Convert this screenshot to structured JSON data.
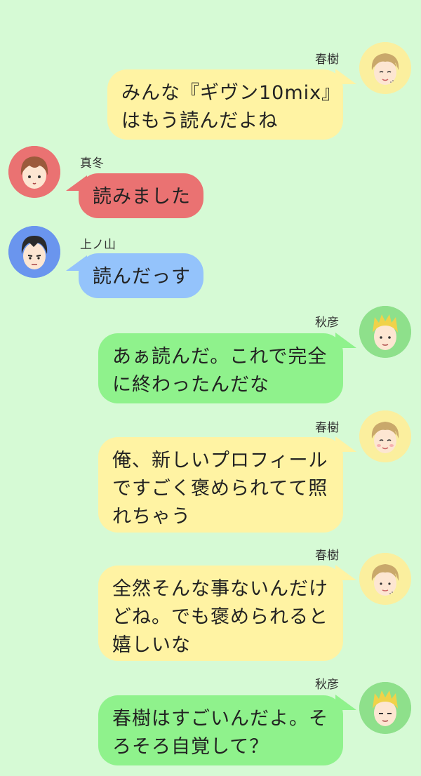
{
  "messages": [
    {
      "speaker": "春樹",
      "lines": [
        "みんな『ギヴン10mix』",
        "はもう読んだよね"
      ]
    },
    {
      "speaker": "真冬",
      "lines": [
        "読みました"
      ]
    },
    {
      "speaker": "上ノ山",
      "lines": [
        "読んだっす"
      ]
    },
    {
      "speaker": "秋彦",
      "lines": [
        "あぁ読んだ。これで完全",
        "に終わったんだな"
      ]
    },
    {
      "speaker": "春樹",
      "lines": [
        "俺、新しいプロフィール",
        "ですごく褒められてて照",
        "れちゃう"
      ]
    },
    {
      "speaker": "春樹",
      "lines": [
        "全然そんな事ないんだけ",
        "どね。でも褒められると",
        "嬉しいな"
      ]
    },
    {
      "speaker": "秋彦",
      "lines": [
        "春樹はすごいんだよ。そ",
        "ろそろ自覚して？"
      ]
    }
  ],
  "colors": {
    "background": "#d6fad5",
    "haruki_bubble": "#fff3a3",
    "akihiko_bubble": "#8ff28c",
    "mafuyu_bubble": "#ea7272",
    "uenoyama_bubble": "#94c3fb"
  },
  "avatars": {
    "haruki": "haruki-face-icon",
    "mafuyu": "mafuyu-face-icon",
    "uenoyama": "uenoyama-face-icon",
    "akihiko": "akihiko-face-icon"
  }
}
